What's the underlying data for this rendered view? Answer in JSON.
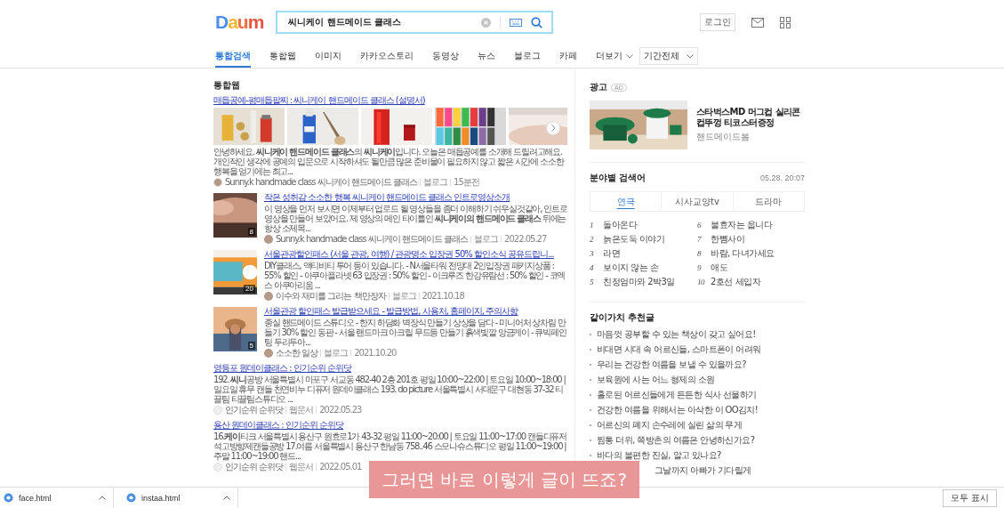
{
  "header": {
    "logo": "Daum",
    "search": {
      "value": "씨니케이 핸드메이드 클래스"
    },
    "login": "로그인"
  },
  "nav": {
    "tabs": [
      {
        "label": "통합검색",
        "selected": true
      },
      {
        "label": "통합웹",
        "selected": false
      },
      {
        "label": "이미지",
        "selected": false
      },
      {
        "label": "카카오스토리",
        "selected": false
      },
      {
        "label": "동영상",
        "selected": false
      },
      {
        "label": "뉴스",
        "selected": false
      },
      {
        "label": "블로그",
        "selected": false
      },
      {
        "label": "카페",
        "selected": false
      }
    ],
    "more": "더보기",
    "period": "기간전체"
  },
  "section_title": "통합웹",
  "results": [
    {
      "kind": "gallery",
      "title": "매듭공예-평매듭팔찌 : 씨니케이 핸드메이드 클래스 (설명서)",
      "description": "안녕하세요. **씨니케이 핸드메이드 클래스**의 **씨니케이**입니다. 오늘은 매듭공예를 소개해 드릴려고해요. 개인적인 생각에 공예의 입문으로 시작하셔도 될만큼 많은 준비물이 필요하지 않고 짧은 시간에 소소한 행복을 얻기에는 최고...",
      "source": "Sunny.k handmade class 씨니케이 핸드메이드 클래스",
      "type": "블로그",
      "date": "15분전"
    },
    {
      "kind": "thumb",
      "title": "작은 성취감 소소한 행복 씨니케이 핸드메이드 클래스 인트로영상소개",
      "description": "이 영상을 먼저 보시면 이제부터 업로드 될 영상들을 좀더 이해하기 쉬우실것같아, 인트로 영상을 만들어 보았어요. 제 영상의 메인 타이틀인 **씨니케이의 핸드메이드 클래스** 뒤에는 항상 소제목...",
      "source": "Sunny.k handmade class 씨니케이 핸드메이드 클래스",
      "type": "블로그",
      "date": "2022.05.27",
      "badge": "8"
    },
    {
      "kind": "thumb",
      "title": "서울관광할인패스 (서울 관광, 여행) / 관광명소 입장권 50% 할인소식 공유드립니...",
      "description": "DIY클래스, 액티비티 투어 등이 있습니다. - N서울타워 전망대 2인입장권 패키지상품 : 55% 할인 - 아쿠아플라넷 63 입장권 : 50% 할인 - 이크루즈 한강유람선 : 50% 할인 - 코엑스 아쿠아리움 ...",
      "source": "이수와 재미를 그리는 책만장자",
      "type": "블로그",
      "date": "2021.10.18",
      "badge": "20"
    },
    {
      "kind": "thumb",
      "title": "서울관광 할인패스 발급받으세요 - 발급방법, 사용처, 홈페이지, 주의사항",
      "description": "종실 핸드메이드 스튜디오 - 한지 하담화 벽장식 만들기 상상을 담다 - 미니어처 상차림 만들기 30% 할인 동판 - 서울 랜드마크 아크릴 무드등 만들기 흙색빛깔 앙금케이 - 큐빅페인팅 두리두아...",
      "source": "소소한 일상",
      "type": "블로그",
      "date": "2021.10.20",
      "badge": "5"
    },
    {
      "kind": "text",
      "title": "영등포 원데이클래스 : 인기순위 순위닷",
      "description": "192. **씨니**공방 서울특별시 마포구 서교동 482-40 2층 201호 평일 10:00~22:00 | 토요일 10:00~18:00 | 일요일 휴무 캔들 천연비누 디퓨저 원데이클래스 193. do picture 서울특별시 서대문구 대현동 37-32 티끌팀 티끌팀스튜디오 ...",
      "source": "인기순위 순위닷",
      "type": "웹문서",
      "date": "2022.05.23"
    },
    {
      "kind": "text",
      "title": "용산 원데이클래스 : 인기순위 순위닷",
      "description": "16.**케이**티크 서울특별시 용산구 원효로1가 43-32 평일 11:00~20:00 | 토요일 11:00~17:00 캔들디퓨저석고방향제캔들공방 17.여름 서울특별시 용산구 한남동 758..46 스모나슈스튜디오 평일 11:00~19:00 | 주말 11:00~19:00 핸드...",
      "source": "인기순위 순위닷",
      "type": "웹문서",
      "date": "2022.05.01"
    }
  ],
  "ad": {
    "label": "광고",
    "badge": "AD",
    "title": "스타벅스MD 머그컵 실리콘컵뚜껑 티코스터증정",
    "seller": "핸드메이드봄"
  },
  "ranking": {
    "title": "분야별 검색어",
    "time": "05.28. 20:07",
    "tabs": [
      {
        "label": "연극",
        "selected": true
      },
      {
        "label": "시사교양tv",
        "selected": false
      },
      {
        "label": "드라마",
        "selected": false
      }
    ],
    "items": [
      {
        "rank": "1",
        "name": "돌아온다"
      },
      {
        "rank": "2",
        "name": "늙은도둑 이야기"
      },
      {
        "rank": "3",
        "name": "라면"
      },
      {
        "rank": "4",
        "name": "보이지 않는 손"
      },
      {
        "rank": "5",
        "name": "친정엄마와 2박3일"
      },
      {
        "rank": "6",
        "name": "불효자는 웁니다"
      },
      {
        "rank": "7",
        "name": "한뼘사이"
      },
      {
        "rank": "8",
        "name": "바람, 다녀가세요"
      },
      {
        "rank": "9",
        "name": "애도"
      },
      {
        "rank": "10",
        "name": "2호선 세입자"
      }
    ]
  },
  "recommend": {
    "title": "같이가치 추천글",
    "items": [
      {
        "text": "마음껏 공부할 수 있는 책상이 갖고 싶어요!",
        "covered": false
      },
      {
        "text": "비대면 시대 속 어르신들, 스마트폰이 어려워",
        "covered": false
      },
      {
        "text": "우리는 건강한 여름을 보낼 수 있을까요?",
        "covered": false
      },
      {
        "text": "보육원에 사는 어느 형제의 소원",
        "covered": false
      },
      {
        "text": "홀로된 어르신들에게 든든한 식사 선물하기",
        "covered": false
      },
      {
        "text": "건강한 여름을 위해서는 아삭한 이 OO김치!",
        "covered": false
      },
      {
        "text": "어르신의 폐지 손수레에 실린 삶의 무게",
        "covered": false
      },
      {
        "text": "찜통 더위, 쪽방촌의 여름은 안녕하신가요?",
        "covered": false
      },
      {
        "text": "바다의 불편한 진실, 알고 있나요?",
        "covered": false
      },
      {
        "text": "그날까지 아빠가 기다릴게",
        "covered": true
      }
    ]
  },
  "downloads": {
    "files": [
      "face.html",
      "instaa.html"
    ],
    "show_all": "모두 표시"
  },
  "subtitle": "그러면 바로 이렇게 글이 뜨죠?"
}
